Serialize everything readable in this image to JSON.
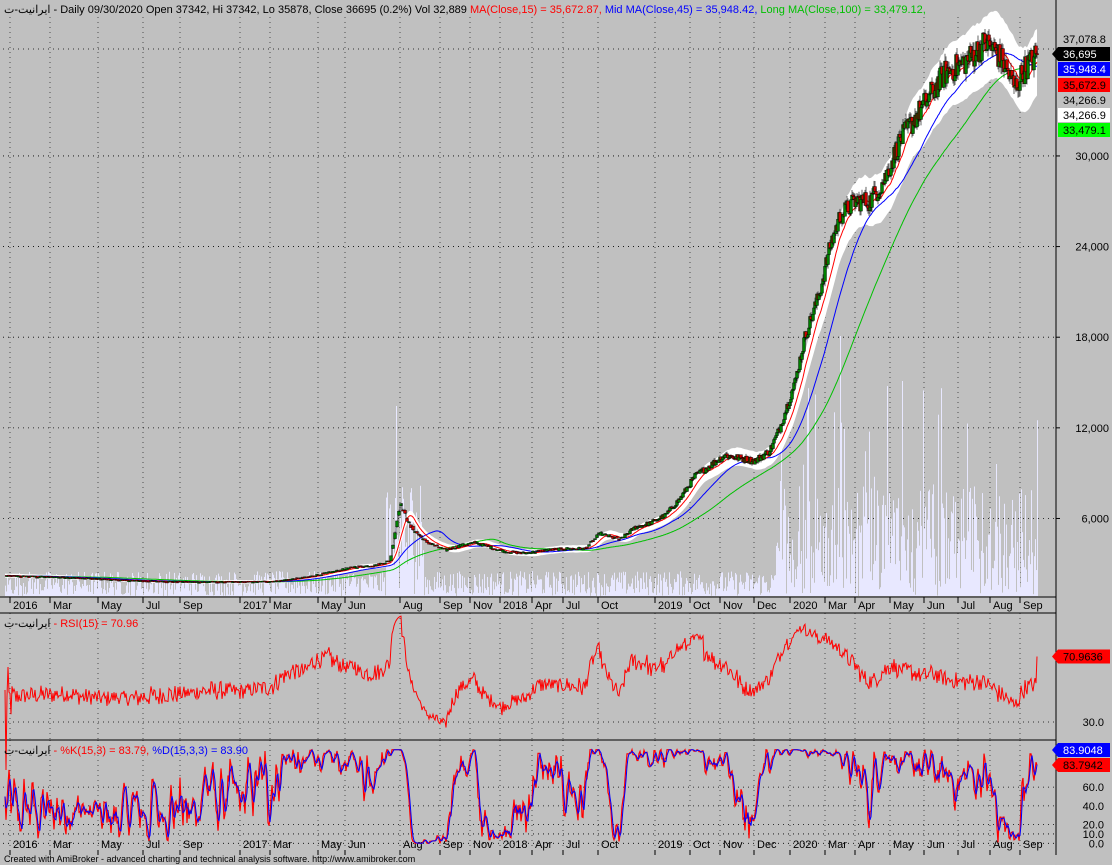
{
  "header": {
    "symbol": "ایرانیت-ت",
    "info": " - Daily 09/30/2020 Open 37342, Hi 37342, Lo 35878, Close 36695 (0.2%) Vol 32,889 ",
    "ma_short": "MA(Close,15) = 35,672.87,",
    "ma_mid": " Mid MA(Close,45) = 35,948.42,",
    "ma_long": " Long MA(Close,100) = 33,479.12,"
  },
  "rsi_header": {
    "symbol": "ایرانیت-ت",
    "label": " - RSI(15) = 70.96"
  },
  "stoch_header": {
    "symbol": "ایرانیت-ت",
    "k": " - %K(15,3) = 83.79,",
    "d": " %D(15,3,3) = 83.90"
  },
  "footer": "Created with AmiBroker - advanced charting and technical analysis software. http://www.amibroker.com",
  "colors": {
    "bg": "#c0c0c0",
    "ma_short": "#ff0000",
    "ma_mid": "#0000ff",
    "ma_long": "#00c000",
    "rsi": "#ff0000",
    "k": "#ff0000",
    "d": "#0000ff",
    "volume": "#e8e8ff"
  },
  "chart_data": [
    {
      "type": "candlestick",
      "pane": "price",
      "x_labels": [
        "2016",
        "Mar",
        "May",
        "Jul",
        "Sep",
        "2017",
        "Mar",
        "May",
        "Jun",
        "Aug",
        "Sep",
        "Nov",
        "2018",
        "Apr",
        "Jul",
        "Oct",
        "2019",
        "Oct",
        "Nov",
        "Dec",
        "2020",
        "Mar",
        "Apr",
        "May",
        "Jun",
        "Jul",
        "Aug",
        "Sep"
      ],
      "y_ticks": [
        6000,
        12000,
        18000,
        24000,
        30000
      ],
      "y_tick_labels": [
        "6,000",
        "12,000",
        "18,000",
        "24,000",
        "30,000"
      ],
      "ylim": [
        1000,
        39000
      ],
      "price_labels": [
        {
          "text": "37,078.8",
          "value": 37078.8,
          "bg": "#c0c0c0",
          "fg": "#000000"
        },
        {
          "text": "36,695",
          "value": 36695,
          "bg": "#000000",
          "fg": "#ffffff"
        },
        {
          "text": "35,948.4",
          "value": 35948.4,
          "bg": "#0000ff",
          "fg": "#ffffff"
        },
        {
          "text": "35,672.9",
          "value": 35672.9,
          "bg": "#ff0000",
          "fg": "#000000"
        },
        {
          "text": "34,266.9",
          "value": 34266.9,
          "bg": "#c0c0c0",
          "fg": "#000000"
        },
        {
          "text": "34,266.9",
          "value": 34266.9,
          "bg": "#ffffff",
          "fg": "#000000"
        },
        {
          "text": "33,479.1",
          "value": 33479.1,
          "bg": "#00ff00",
          "fg": "#000000"
        }
      ],
      "anchors": [
        [
          0,
          2200
        ],
        [
          60,
          2100
        ],
        [
          120,
          1900
        ],
        [
          180,
          1800
        ],
        [
          240,
          1800
        ],
        [
          270,
          1850
        ],
        [
          300,
          2100
        ],
        [
          330,
          2500
        ],
        [
          350,
          2800
        ],
        [
          370,
          2900
        ],
        [
          385,
          3200
        ],
        [
          395,
          7000
        ],
        [
          405,
          5500
        ],
        [
          420,
          4500
        ],
        [
          440,
          3900
        ],
        [
          455,
          4200
        ],
        [
          470,
          4400
        ],
        [
          485,
          4100
        ],
        [
          500,
          3800
        ],
        [
          520,
          3700
        ],
        [
          540,
          3900
        ],
        [
          560,
          4000
        ],
        [
          580,
          4000
        ],
        [
          595,
          5000
        ],
        [
          615,
          4600
        ],
        [
          630,
          5400
        ],
        [
          645,
          5700
        ],
        [
          660,
          6200
        ],
        [
          675,
          7300
        ],
        [
          690,
          8800
        ],
        [
          705,
          9500
        ],
        [
          720,
          10200
        ],
        [
          735,
          10000
        ],
        [
          750,
          9800
        ],
        [
          765,
          10500
        ],
        [
          775,
          12000
        ],
        [
          790,
          15000
        ],
        [
          800,
          18000
        ],
        [
          815,
          21000
        ],
        [
          825,
          24000
        ],
        [
          835,
          26000
        ],
        [
          850,
          27000
        ],
        [
          865,
          27000
        ],
        [
          880,
          28500
        ],
        [
          895,
          31000
        ],
        [
          910,
          32500
        ],
        [
          925,
          34000
        ],
        [
          940,
          35500
        ],
        [
          955,
          36000
        ],
        [
          965,
          36500
        ],
        [
          980,
          37500
        ],
        [
          990,
          37000
        ],
        [
          1000,
          36000
        ],
        [
          1010,
          34500
        ],
        [
          1020,
          35800
        ],
        [
          1032,
          36695
        ]
      ],
      "series": [
        {
          "name": "MA(Close,15)",
          "period": 15
        },
        {
          "name": "Mid MA(Close,45)",
          "period": 45
        },
        {
          "name": "Long MA(Close,100)",
          "period": 100
        }
      ]
    },
    {
      "type": "line",
      "pane": "rsi",
      "series": [
        {
          "name": "RSI(15)"
        }
      ],
      "y_ticks": [
        30
      ],
      "y_tick_labels": [
        "30.0"
      ],
      "ylim": [
        20,
        95
      ],
      "last_value_label": "70.9636",
      "last_value": 70.96
    },
    {
      "type": "line",
      "pane": "stochastic",
      "series": [
        {
          "name": "%K(15,3)"
        },
        {
          "name": "%D(15,3,3)"
        }
      ],
      "y_ticks": [
        0,
        10,
        20,
        40,
        60
      ],
      "y_tick_labels": [
        "0.0",
        "10.0",
        "20.0",
        "40.0",
        "60.0"
      ],
      "ylim": [
        -5,
        105
      ],
      "last_value_labels": [
        {
          "text": "83.9048",
          "bg": "#0000ff",
          "fg": "#ffffff"
        },
        {
          "text": "83.7942",
          "bg": "#ff0000",
          "fg": "#000000"
        }
      ]
    }
  ]
}
